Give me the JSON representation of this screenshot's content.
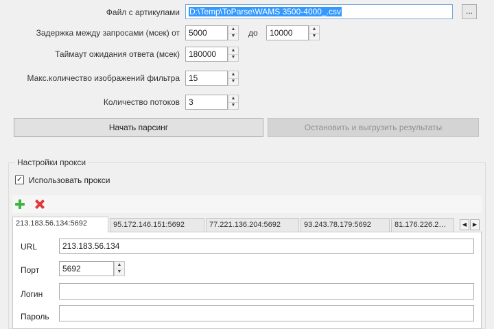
{
  "form": {
    "file_label": "Файл с артикулами",
    "file_value": "D:\\Temp\\ToParse\\WAMS 3500-4000_.csv",
    "browse_label": "...",
    "delay_label": "Задержка между запросами (мсек) от",
    "delay_from": "5000",
    "delay_to_label": "до",
    "delay_to": "10000",
    "timeout_label": "Таймаут ожидания ответа (мсек)",
    "timeout_value": "180000",
    "max_images_label": "Макс.количество изображений фильтра",
    "max_images_value": "15",
    "threads_label": "Количество потоков",
    "threads_value": "3",
    "start_button": "Начать парсинг",
    "stop_button": "Остановить и выгрузить результаты"
  },
  "proxy": {
    "group_title": "Настройки прокси",
    "use_proxy_label": "Использовать прокси",
    "use_proxy_checked": true,
    "tabs": [
      {
        "label": "213.183.56.134:5692",
        "active": true
      },
      {
        "label": "95.172.146.151:5692",
        "active": false
      },
      {
        "label": "77.221.136.204:5692",
        "active": false
      },
      {
        "label": "93.243.78.179:5692",
        "active": false
      },
      {
        "label": "81.176.226.2…",
        "active": false
      }
    ],
    "url_label": "URL",
    "url_value": "213.183.56.134",
    "port_label": "Порт",
    "port_value": "5692",
    "login_label": "Логин",
    "login_value": "",
    "password_label": "Пароль",
    "password_value": ""
  },
  "icons": {
    "add": "plus-icon",
    "delete": "x-icon",
    "spin_up": "▲",
    "spin_down": "▼",
    "tab_left": "◀",
    "tab_right": "▶",
    "check_mark": "✓"
  }
}
